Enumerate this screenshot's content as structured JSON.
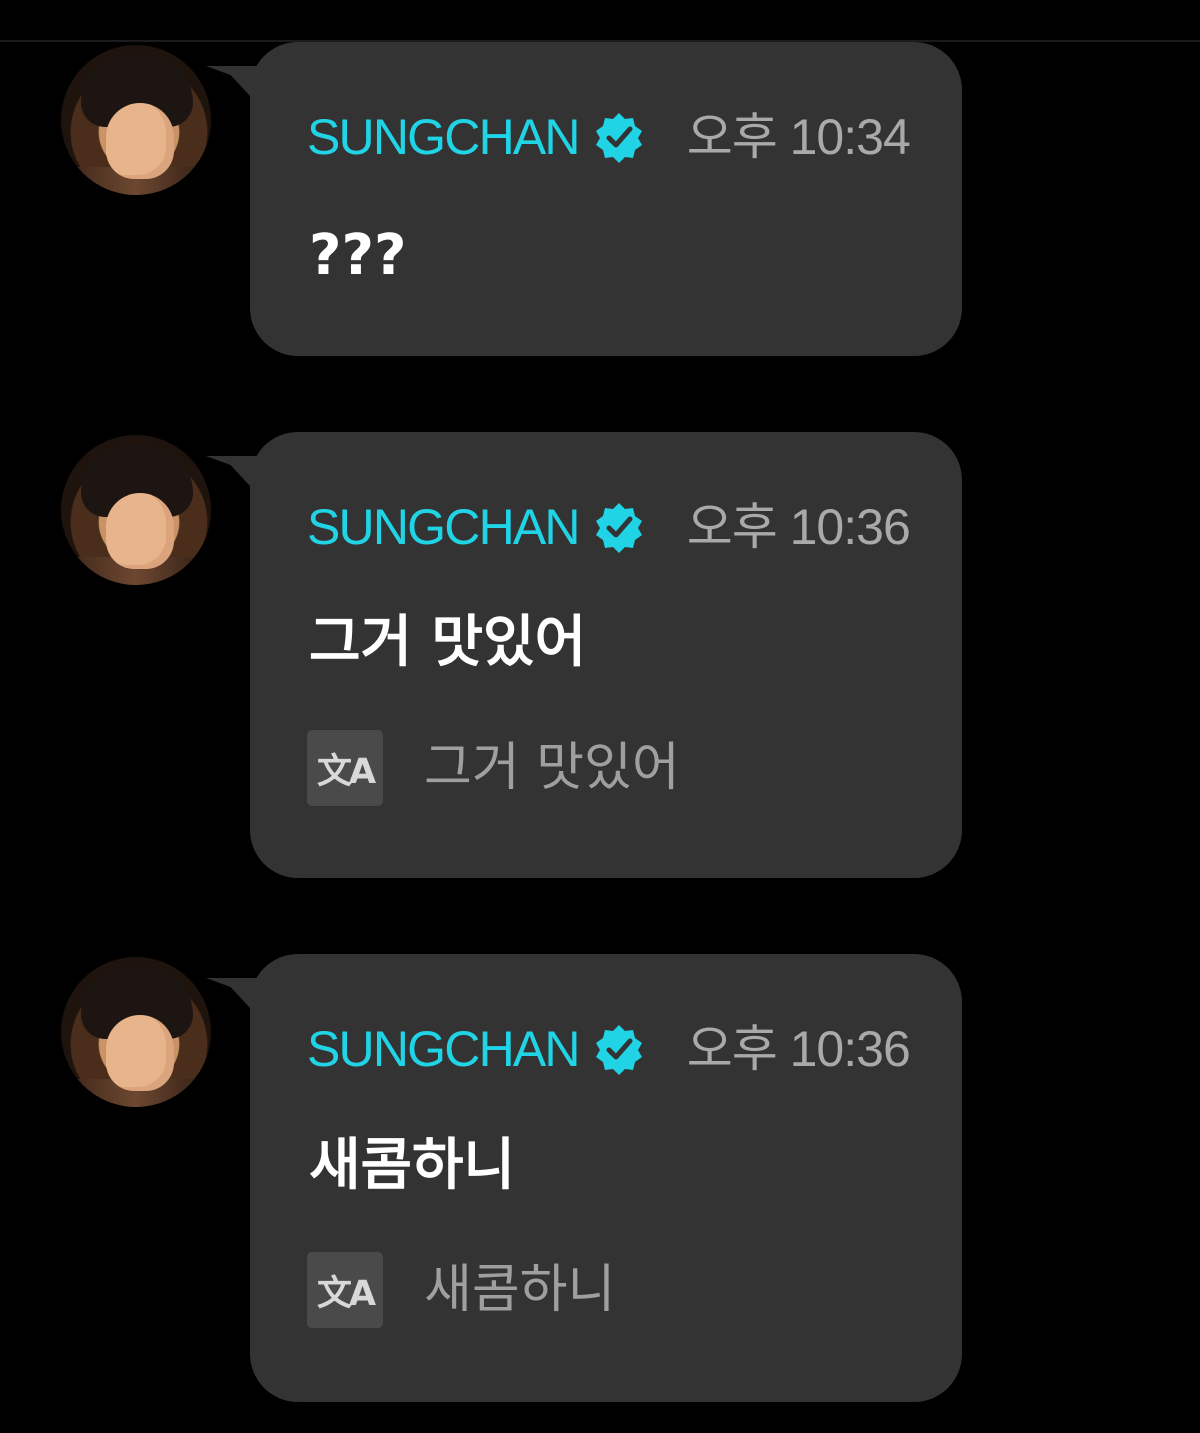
{
  "messages": [
    {
      "sender": "SUNGCHAN",
      "time": "오후 10:34",
      "text": "???",
      "translation": ""
    },
    {
      "sender": "SUNGCHAN",
      "time": "오후 10:36",
      "text": "그거 맛있어",
      "translation": "그거 맛있어"
    },
    {
      "sender": "SUNGCHAN",
      "time": "오후 10:36",
      "text": "새콤하니",
      "translation": "새콤하니"
    }
  ],
  "icons": {
    "verified": "verified-badge-icon",
    "translate": "translate-icon",
    "translate_glyph": "文A"
  },
  "colors": {
    "background": "#000000",
    "bubble": "#333333",
    "name": "#20d4e6",
    "time": "#a9a9a9",
    "message_text": "#ffffff",
    "translation_text": "#9f9f9f"
  }
}
